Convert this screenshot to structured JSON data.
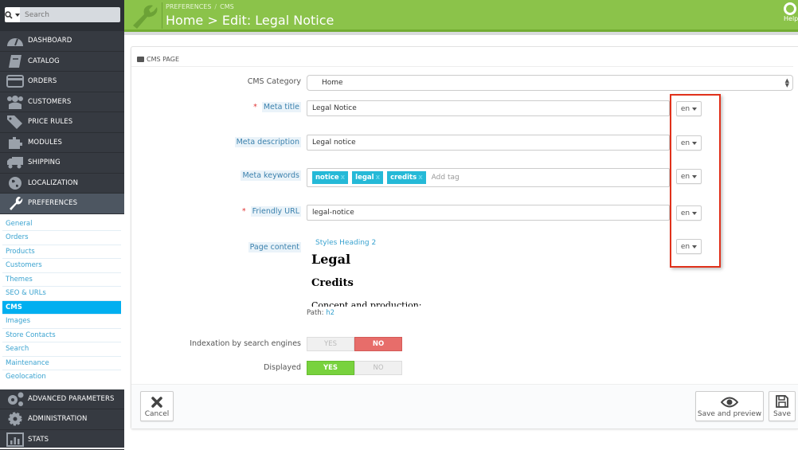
{
  "sidebar": {
    "search_placeholder": "Search",
    "search_icon": "search-icon",
    "items": [
      {
        "label": "DASHBOARD",
        "icon": "dashboard-icon"
      },
      {
        "label": "CATALOG",
        "icon": "catalog-icon"
      },
      {
        "label": "ORDERS",
        "icon": "credit-card-icon"
      },
      {
        "label": "CUSTOMERS",
        "icon": "users-icon"
      },
      {
        "label": "PRICE RULES",
        "icon": "tag-icon"
      },
      {
        "label": "MODULES",
        "icon": "puzzle-icon"
      },
      {
        "label": "SHIPPING",
        "icon": "truck-icon"
      },
      {
        "label": "LOCALIZATION",
        "icon": "globe-icon"
      },
      {
        "label": "PREFERENCES",
        "icon": "wrench-icon",
        "active": true
      }
    ],
    "submenu": [
      "General",
      "Orders",
      "Products",
      "Customers",
      "Themes",
      "SEO & URLs",
      "CMS",
      "Images",
      "Store Contacts",
      "Search",
      "Maintenance",
      "Geolocation"
    ],
    "submenu_active": "CMS",
    "bottom_items": [
      {
        "label": "ADVANCED PARAMETERS",
        "icon": "gears-icon"
      },
      {
        "label": "ADMINISTRATION",
        "icon": "gear-icon"
      },
      {
        "label": "STATS",
        "icon": "bar-chart-icon"
      }
    ]
  },
  "header": {
    "breadcrumb": [
      "PREFERENCES",
      "CMS"
    ],
    "breadcrumb_sep": "/",
    "title": "Home > Edit: Legal Notice",
    "help_label": "Help",
    "accent": "#8bc34a"
  },
  "panel": {
    "title": "CMS PAGE",
    "fields": {
      "cms_category": {
        "label": "CMS Category",
        "value": "Home"
      },
      "meta_title": {
        "label": "Meta title",
        "value": "Legal Notice",
        "required": true,
        "lang": "en"
      },
      "meta_description": {
        "label": "Meta description",
        "value": "Legal notice",
        "lang": "en"
      },
      "meta_keywords": {
        "label": "Meta keywords",
        "tags": [
          "notice",
          "legal",
          "credits"
        ],
        "tag_remove": "x",
        "placeholder": "Add tag",
        "lang": "en"
      },
      "friendly_url": {
        "label": "Friendly URL",
        "value": "legal-notice",
        "required": true,
        "lang": "en"
      },
      "page_content": {
        "label": "Page content",
        "lang": "en",
        "toolbar_styles": "Styles",
        "toolbar_style_value": "Heading 2",
        "content": {
          "h1": "Legal",
          "h2": "Credits",
          "p": "Concept and production:"
        },
        "path_label": "Path:",
        "path_value": "h2"
      },
      "indexation": {
        "label": "Indexation by search engines",
        "yes": "YES",
        "no": "NO",
        "value": "NO"
      },
      "displayed": {
        "label": "Displayed",
        "yes": "YES",
        "no": "NO",
        "value": "YES"
      }
    },
    "required_mark": "*",
    "footer": {
      "cancel": "Cancel",
      "save_preview": "Save and preview",
      "save": "Save"
    }
  },
  "annotation_color": "#e0311b"
}
